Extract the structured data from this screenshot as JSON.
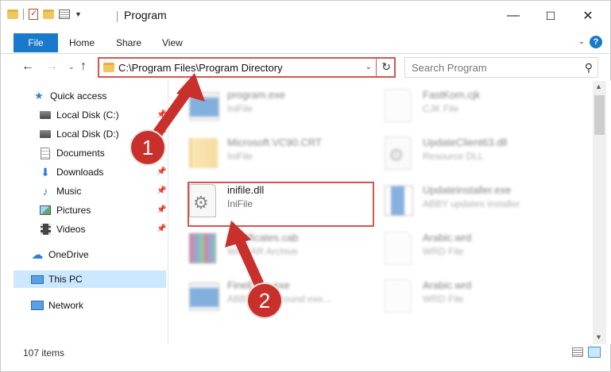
{
  "window": {
    "title": "Program",
    "minimize": "—",
    "maximize": "☐",
    "close": "✕"
  },
  "ribbon": {
    "tabs": [
      "File",
      "Home",
      "Share",
      "View"
    ]
  },
  "nav": {
    "address": "C:\\Program Files\\Program Directory",
    "search_placeholder": "Search Program"
  },
  "sidebar": {
    "items": [
      {
        "label": "Quick access",
        "icon": "star-icon"
      },
      {
        "label": "Local Disk (C:)",
        "icon": "drive-icon",
        "pinned": true
      },
      {
        "label": "Local Disk (D:)",
        "icon": "drive-icon",
        "pinned": true
      },
      {
        "label": "Documents",
        "icon": "documents-icon",
        "pinned": true
      },
      {
        "label": "Downloads",
        "icon": "download-icon",
        "pinned": true
      },
      {
        "label": "Music",
        "icon": "music-icon",
        "pinned": true
      },
      {
        "label": "Pictures",
        "icon": "pictures-icon",
        "pinned": true
      },
      {
        "label": "Videos",
        "icon": "videos-icon",
        "pinned": true
      },
      {
        "label": "OneDrive",
        "icon": "cloud-icon"
      },
      {
        "label": "This PC",
        "icon": "computer-icon",
        "selected": true
      },
      {
        "label": "Network",
        "icon": "network-icon"
      }
    ]
  },
  "files": [
    {
      "name": "program.exe",
      "type": "IniFile",
      "icon": "application-icon"
    },
    {
      "name": "FastKorn.cjk",
      "type": "CJK File",
      "icon": "file-icon"
    },
    {
      "name": "Microsoft.VC90.CRT",
      "type": "IniFile",
      "icon": "folder-icon"
    },
    {
      "name": "UpdateClient63.dll",
      "type": "Resource DLL",
      "icon": "dll-icon"
    },
    {
      "name": "inifile.dll",
      "type": "IniFile",
      "icon": "dll-icon"
    },
    {
      "name": "UpdateInstaller.exe",
      "type": "ABBY updates installer",
      "icon": "installer-icon"
    },
    {
      "name": "Certificates.cab",
      "type": "WinRAR Archive",
      "icon": "archive-icon"
    },
    {
      "name": "Arabic.wrd",
      "type": "WRD File",
      "icon": "file-icon"
    },
    {
      "name": "FineExec.exe",
      "type": "ABBY background exe...",
      "icon": "application-icon"
    },
    {
      "name": "Arabic.wrd",
      "type": "WRD File",
      "icon": "file-icon"
    }
  ],
  "annotations": {
    "badge1": "1",
    "badge2": "2",
    "color": "#c9302c"
  },
  "status": {
    "count": "107 items"
  }
}
